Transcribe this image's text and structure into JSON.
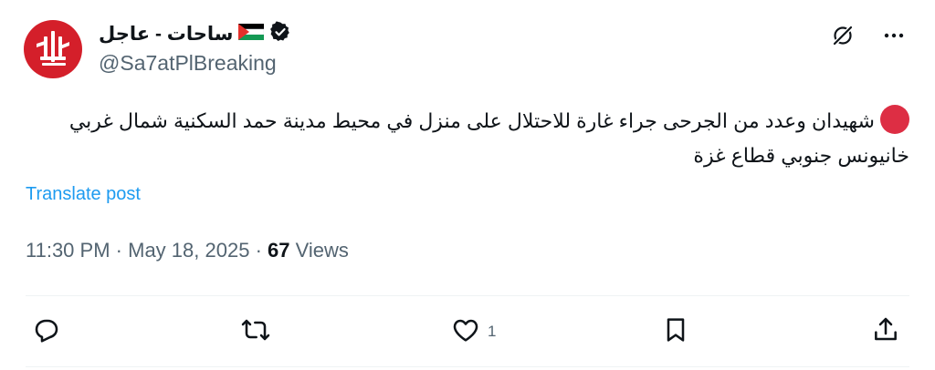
{
  "author": {
    "name": "ساحات - عاجل",
    "handle": "@Sa7atPlBreaking",
    "verified": true,
    "flag": "Palestine",
    "avatar_text": "ساحات"
  },
  "post": {
    "text": "شهيدان وعدد من الجرحى جراء غارة للاحتلال على منزل في محيط مدينة حمد السكنية شمال غربي خانيونس جنوبي قطاع غزة",
    "translate_label": "Translate post",
    "time": "11:30 PM",
    "date": "May 18, 2025",
    "views_count": "67",
    "views_label": "Views"
  },
  "actions": {
    "reply": {
      "icon": "reply-icon",
      "count": ""
    },
    "repost": {
      "icon": "repost-icon",
      "count": ""
    },
    "like": {
      "icon": "heart-icon",
      "count": "1"
    },
    "bookmark": {
      "icon": "bookmark-icon",
      "count": ""
    },
    "share": {
      "icon": "share-icon",
      "count": ""
    }
  },
  "colors": {
    "accent": "#1d9bf0",
    "secondary_text": "#536471",
    "avatar_bg": "#d41f2a",
    "dot": "#dd2e44"
  }
}
